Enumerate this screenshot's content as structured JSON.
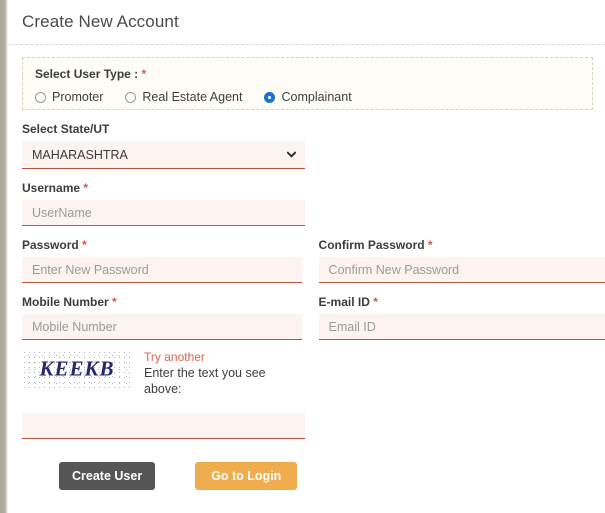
{
  "page": {
    "title": "Create New Account"
  },
  "user_type": {
    "label": "Select User Type :",
    "required_marker": "*",
    "options": [
      {
        "label": "Promoter",
        "selected": false
      },
      {
        "label": "Real Estate Agent",
        "selected": false
      },
      {
        "label": "Complainant",
        "selected": true
      }
    ]
  },
  "fields": {
    "state": {
      "label": "Select State/UT",
      "required_marker": "",
      "value": "MAHARASHTRA",
      "options": [
        "MAHARASHTRA"
      ]
    },
    "username": {
      "label": "Username",
      "required_marker": "*",
      "value": "",
      "placeholder": "UserName"
    },
    "password": {
      "label": "Password",
      "required_marker": "*",
      "value": "",
      "placeholder": "Enter New Password"
    },
    "confirm_password": {
      "label": "Confirm Password",
      "required_marker": "*",
      "value": "",
      "placeholder": "Confirm New Password"
    },
    "mobile": {
      "label": "Mobile Number",
      "required_marker": "*",
      "value": "",
      "placeholder": "Mobile Number"
    },
    "email": {
      "label": "E-mail ID",
      "required_marker": "*",
      "value": "",
      "placeholder": "Email ID"
    },
    "captcha": {
      "image_text": "KEEKB",
      "try_another_label": "Try another",
      "hint": "Enter the text you see above:",
      "value": "",
      "placeholder": ""
    }
  },
  "buttons": {
    "create_user": "Create User",
    "go_to_login": "Go to Login"
  },
  "colors": {
    "accent_underline": "#b9563c",
    "field_background": "#fdf3f1",
    "required_marker": "#d9534f",
    "link": "#e0644f",
    "primary_button": "#555555",
    "secondary_button": "#f0ad4e",
    "usertype_box_background": "#fdfcf6",
    "usertype_box_border": "#ddd3bb",
    "captcha_text": "#262673",
    "radio_selected": "#1a73d6"
  },
  "icons": {
    "chevron_down": "chevron-down-icon"
  }
}
